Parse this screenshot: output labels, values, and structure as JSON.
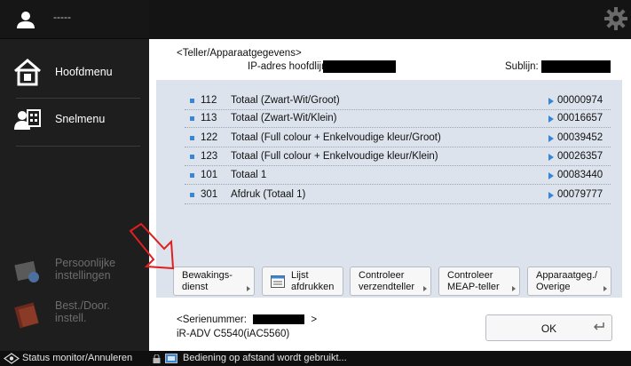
{
  "user": {
    "name": "-----"
  },
  "sidebar": {
    "items": [
      {
        "label": "Hoofdmenu",
        "icon": "home-icon",
        "enabled": true
      },
      {
        "label": "Snelmenu",
        "icon": "quick-menu-icon",
        "enabled": true
      },
      {
        "label": "Persoonlijke instellingen",
        "line1": "Persoonlijke",
        "line2": "instellingen",
        "icon": "personal-settings-icon",
        "enabled": false
      },
      {
        "label": "Best./Door. instell.",
        "line1": "Best./Door.",
        "line2": "instell.",
        "icon": "folder-icon",
        "enabled": false
      }
    ]
  },
  "topbar": {
    "settings_icon": "gear-icon"
  },
  "header": {
    "title": "<Teller/Apparaatgegevens>",
    "ip_label": "IP-adres hoofdlijn:",
    "sub_label": "Sublijn:"
  },
  "counters": [
    {
      "num": "112",
      "desc": "Totaal (Zwart-Wit/Groot)",
      "value": "00000974"
    },
    {
      "num": "113",
      "desc": "Totaal (Zwart-Wit/Klein)",
      "value": "00016657"
    },
    {
      "num": "122",
      "desc": "Totaal (Full colour + Enkelvoudige kleur/Groot)",
      "value": "00039452"
    },
    {
      "num": "123",
      "desc": "Totaal (Full colour + Enkelvoudige kleur/Klein)",
      "value": "00026357"
    },
    {
      "num": "101",
      "desc": "Totaal 1",
      "value": "00083440"
    },
    {
      "num": "301",
      "desc": "Afdruk (Totaal 1)",
      "value": "00079777"
    }
  ],
  "buttons": {
    "monitoring": {
      "line1": "Bewakings-",
      "line2": "dienst"
    },
    "print_list": {
      "line1": "Lijst",
      "line2": "afdrukken"
    },
    "check_send": {
      "line1": "Controleer",
      "line2": "verzendteller"
    },
    "check_meap": {
      "line1": "Controleer",
      "line2": "MEAP-teller"
    },
    "device_info": {
      "line1": "Apparaatgeg./",
      "line2": "Overige"
    }
  },
  "footer": {
    "serial_prefix": "<Serienummer:",
    "serial_suffix": ">",
    "model": "iR-ADV C5540(iAC5560)",
    "ok_label": "OK"
  },
  "statusbar": {
    "left_label": "Status monitor/Annuleren",
    "message": "Bediening op afstand wordt gebruikt..."
  },
  "colors": {
    "accent": "#3a86d6",
    "panel": "#dde3ec",
    "annotation_arrow": "#e02020"
  }
}
